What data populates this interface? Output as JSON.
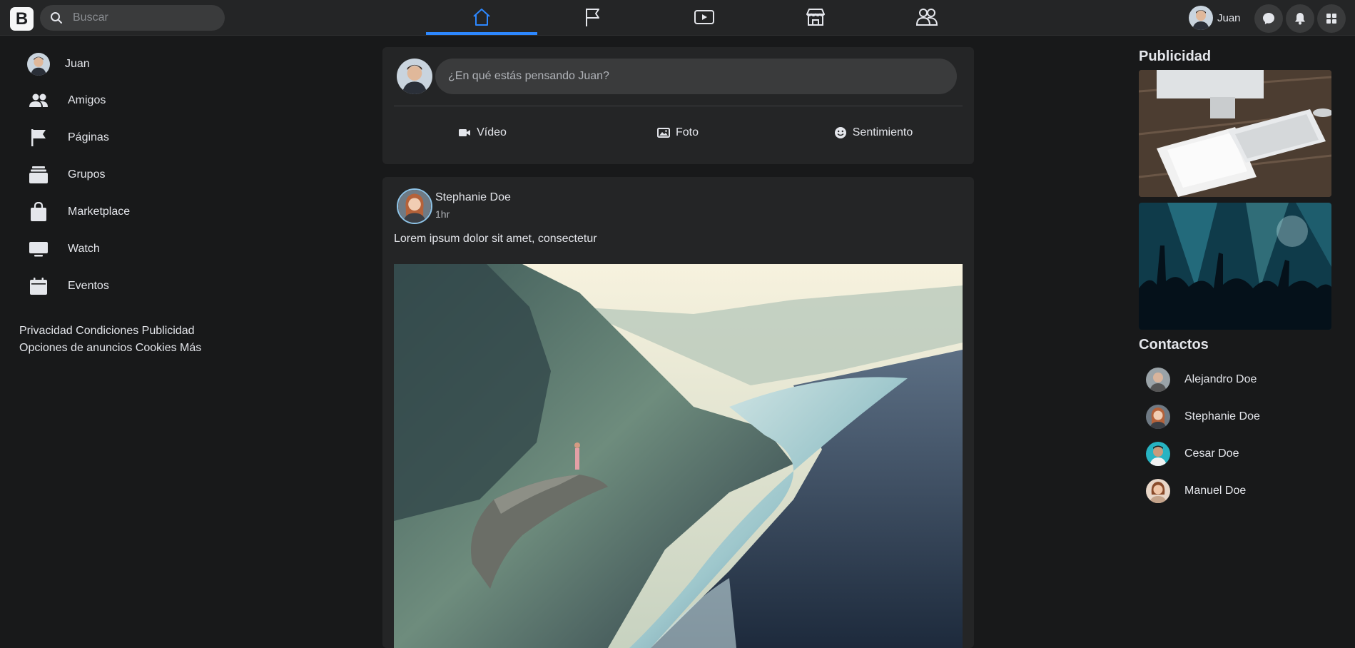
{
  "topbar": {
    "logo": "B",
    "search": {
      "placeholder": "Buscar",
      "value": ""
    },
    "tabs": [
      {
        "icon": "home-icon",
        "active": true
      },
      {
        "icon": "flag-icon",
        "active": false
      },
      {
        "icon": "video-play-icon",
        "active": false
      },
      {
        "icon": "store-icon",
        "active": false
      },
      {
        "icon": "groups-icon",
        "active": false
      }
    ],
    "profile": {
      "name": "Juan"
    },
    "accent": "#2d88ff"
  },
  "sidebar": {
    "profile_name": "Juan",
    "items": [
      {
        "label": "Amigos",
        "icon": "friends-icon"
      },
      {
        "label": "Páginas",
        "icon": "flag-icon"
      },
      {
        "label": "Grupos",
        "icon": "groups-stack-icon"
      },
      {
        "label": "Marketplace",
        "icon": "shopping-bag-icon"
      },
      {
        "label": "Watch",
        "icon": "tv-icon"
      },
      {
        "label": "Eventos",
        "icon": "calendar-icon"
      }
    ],
    "footer": {
      "privacy": "Privacidad",
      "terms": "Condiciones",
      "advertising": "Publicidad",
      "ad_choices": "Opciones de anuncios",
      "cookies": "Cookies",
      "more": "Más"
    }
  },
  "composer": {
    "placeholder": "¿En qué estás pensando Juan?",
    "actions": [
      {
        "label": "Vídeo",
        "icon": "video-camera-icon"
      },
      {
        "label": "Foto",
        "icon": "photo-icon"
      },
      {
        "label": "Sentimiento",
        "icon": "smiley-icon"
      }
    ]
  },
  "post": {
    "author": "Stephanie Doe",
    "time": "1hr",
    "text": "Lorem ipsum dolor sit amet, consectetur"
  },
  "right": {
    "ads_title": "Publicidad",
    "contacts_title": "Contactos",
    "contacts": [
      {
        "name": "Alejandro Doe"
      },
      {
        "name": "Stephanie Doe"
      },
      {
        "name": "Cesar Doe"
      },
      {
        "name": "Manuel Doe"
      }
    ]
  },
  "colors": {
    "background": "#18191a",
    "surface": "#242526",
    "input": "#3a3b3c",
    "text": "#e4e6eb",
    "muted": "#b0b3b8"
  }
}
